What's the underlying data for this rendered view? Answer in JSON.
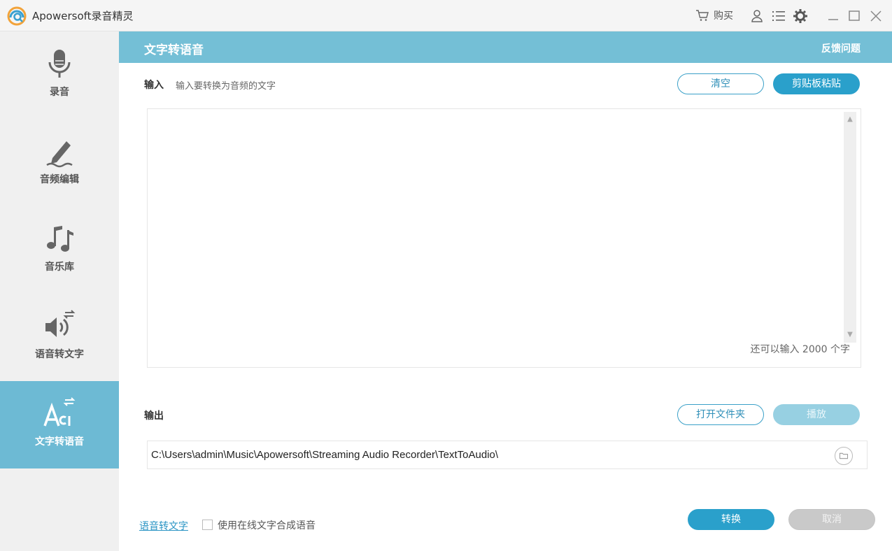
{
  "window": {
    "title": "Apowersoft录音精灵",
    "cart_label": "购买"
  },
  "sidebar": {
    "items": [
      {
        "label": "录音",
        "icon": "microphone-icon"
      },
      {
        "label": "音频编辑",
        "icon": "pen-wave-icon"
      },
      {
        "label": "音乐库",
        "icon": "music-notes-icon"
      },
      {
        "label": "语音转文字",
        "icon": "speaker-convert-icon"
      },
      {
        "label": "文字转语音",
        "icon": "text-convert-icon",
        "active": true
      }
    ]
  },
  "header": {
    "title": "文字转语音",
    "feedback": "反馈问题"
  },
  "input": {
    "label": "输入",
    "hint": "输入要转换为音频的文字",
    "clear_button": "清空",
    "paste_button": "剪贴板粘贴",
    "char_count_text": "还可以输入 2000 个字"
  },
  "output": {
    "label": "输出",
    "open_folder_button": "打开文件夹",
    "play_button": "播放",
    "path": "C:\\Users\\admin\\Music\\Apowersoft\\Streaming Audio Recorder\\TextToAudio\\"
  },
  "footer": {
    "speech_to_text_link": "语音转文字",
    "online_synthesis_label": "使用在线文字合成语音",
    "online_synthesis_checked": false,
    "convert_button": "转换",
    "cancel_button": "取消"
  },
  "colors": {
    "header_bg": "#74bfd6",
    "active_nav_bg": "#6dbad4",
    "primary_button": "#2aa0cb",
    "sidebar_bg": "#f0f0f0"
  }
}
